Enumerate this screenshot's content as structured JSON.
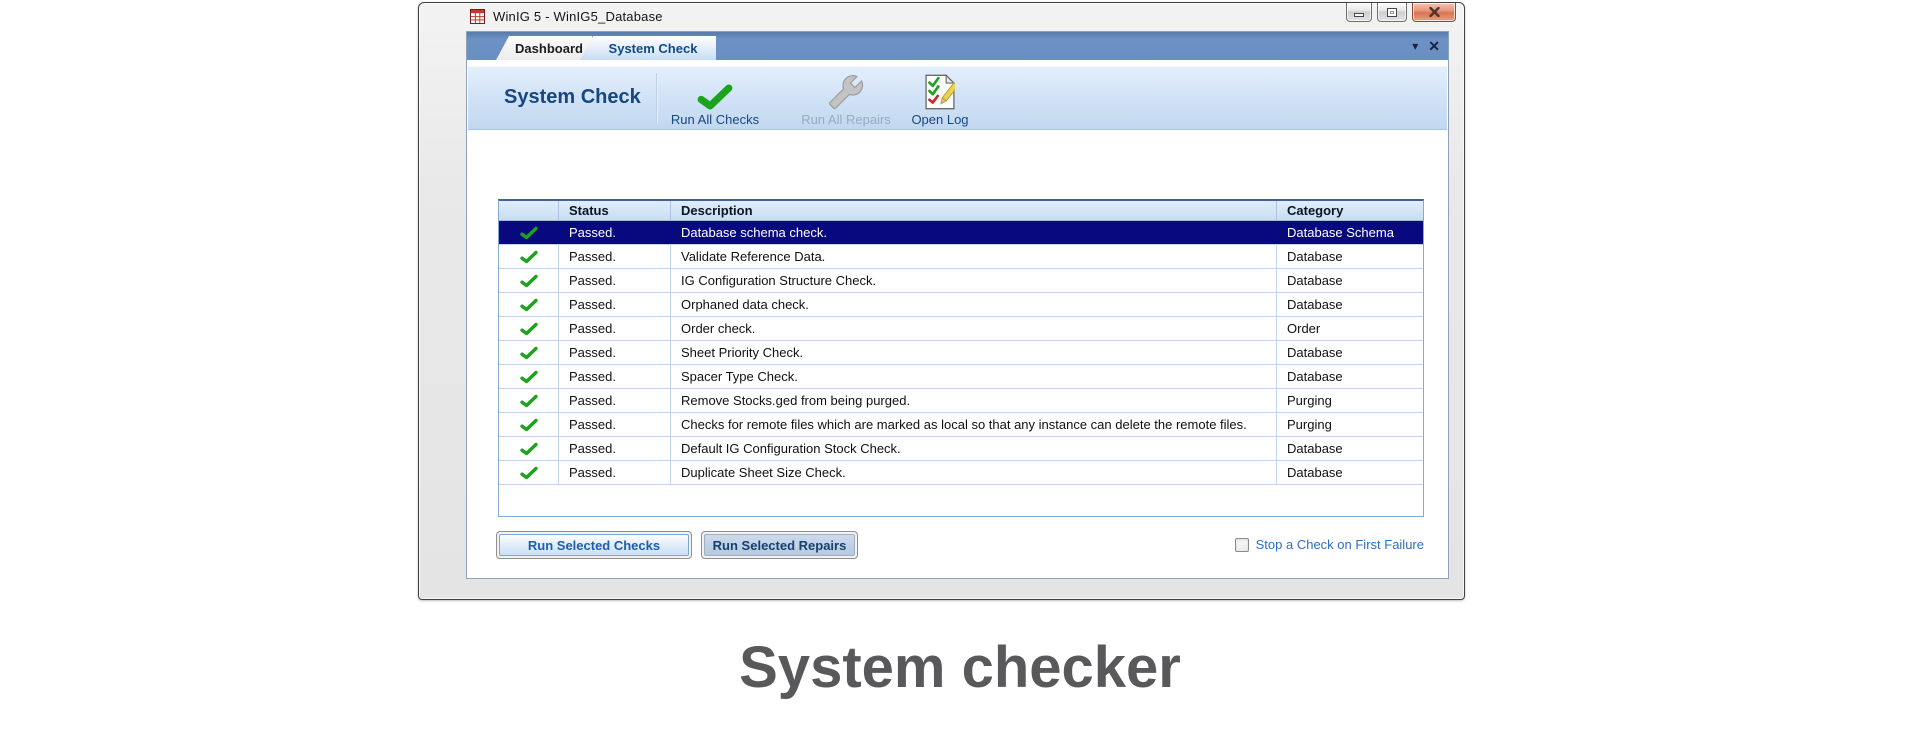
{
  "window": {
    "title": "WinIG 5 - WinIG5_Database",
    "controls": {
      "minimize": "minimize-icon",
      "maximize": "maximize-icon",
      "close": "close-icon"
    }
  },
  "tabs": [
    {
      "label": "Dashboard",
      "active": false
    },
    {
      "label": "System Check",
      "active": true
    }
  ],
  "tab_strip": {
    "icons": [
      "chevron-down-icon",
      "close-icon"
    ]
  },
  "banner": {
    "title": "System Check",
    "buttons": [
      {
        "label": "Run All Checks",
        "icon": "green-check-icon",
        "enabled": true
      },
      {
        "label": "Run All Repairs",
        "icon": "wrench-icon",
        "enabled": false
      },
      {
        "label": "Open Log",
        "icon": "log-document-icon",
        "enabled": true
      }
    ]
  },
  "table": {
    "columns": {
      "icon": "",
      "status": "Status",
      "description": "Description",
      "category": "Category"
    },
    "rows": [
      {
        "icon": "green-check-icon",
        "status": "Passed.",
        "description": "Database schema check.",
        "category": "Database Schema",
        "selected": true
      },
      {
        "icon": "green-check-icon",
        "status": "Passed.",
        "description": "Validate Reference Data.",
        "category": "Database",
        "selected": false
      },
      {
        "icon": "green-check-icon",
        "status": "Passed.",
        "description": "IG Configuration Structure Check.",
        "category": "Database",
        "selected": false
      },
      {
        "icon": "green-check-icon",
        "status": "Passed.",
        "description": "Orphaned data check.",
        "category": "Database",
        "selected": false
      },
      {
        "icon": "green-check-icon",
        "status": "Passed.",
        "description": "Order check.",
        "category": "Order",
        "selected": false
      },
      {
        "icon": "green-check-icon",
        "status": "Passed.",
        "description": "Sheet Priority Check.",
        "category": "Database",
        "selected": false
      },
      {
        "icon": "green-check-icon",
        "status": "Passed.",
        "description": "Spacer Type Check.",
        "category": "Database",
        "selected": false
      },
      {
        "icon": "green-check-icon",
        "status": "Passed.",
        "description": "Remove Stocks.ged from being purged.",
        "category": "Purging",
        "selected": false
      },
      {
        "icon": "green-check-icon",
        "status": "Passed.",
        "description": "Checks for remote files which are marked as local so that any instance can delete the remote files.",
        "category": "Purging",
        "selected": false
      },
      {
        "icon": "green-check-icon",
        "status": "Passed.",
        "description": "Default IG Configuration Stock Check.",
        "category": "Database",
        "selected": false
      },
      {
        "icon": "green-check-icon",
        "status": "Passed.",
        "description": "Duplicate Sheet Size Check.",
        "category": "Database",
        "selected": false
      }
    ]
  },
  "footer": {
    "run_selected_checks": "Run Selected Checks",
    "run_selected_repairs": "Run Selected Repairs",
    "stop_on_failure": {
      "label": "Stop a Check on First Failure",
      "checked": false
    }
  },
  "caption": "System checker",
  "colors": {
    "tab_strip_blue": "#6a8fc2",
    "banner_blue_top": "#e4effc",
    "banner_blue_bottom": "#c2d8f0",
    "accent_text_blue": "#17477f",
    "selected_row_navy": "#09097f",
    "check_green": "#1ca31c",
    "link_blue": "#2f6fc1",
    "caption_gray": "#59595b",
    "close_button_red": "#d9744f"
  }
}
